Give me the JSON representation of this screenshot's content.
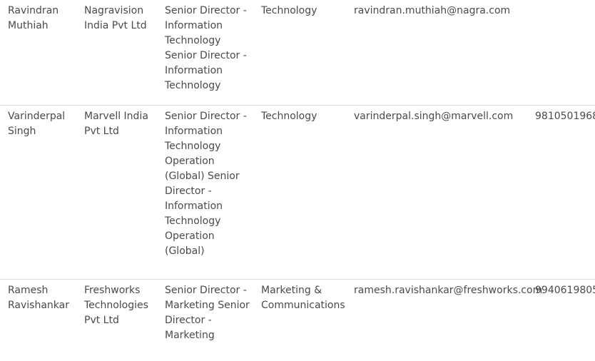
{
  "rows": [
    {
      "name": "Ravindran Muthiah",
      "company": "Nagravision India Pvt Ltd",
      "title": "Senior Director - Information Technology Senior Director - Information Technology",
      "department": "Technology",
      "email": "ravindran.muthiah@nagra.com",
      "phone": ""
    },
    {
      "name": "Varinderpal Singh",
      "company": "Marvell India Pvt Ltd",
      "title": "Senior Director - Information Technology Operation (Global) Senior Director - Information Technology Operation (Global)",
      "department": "Technology",
      "email": "varinderpal.singh@marvell.com",
      "phone": "9810501968"
    },
    {
      "name": "Ramesh Ravishankar",
      "company": "Freshworks Technologies Pvt Ltd",
      "title": "Senior Director - Marketing Senior Director - Marketing",
      "department": "Marketing & Communications",
      "email": "ramesh.ravishankar@freshworks.com",
      "phone": "9940619805"
    }
  ]
}
